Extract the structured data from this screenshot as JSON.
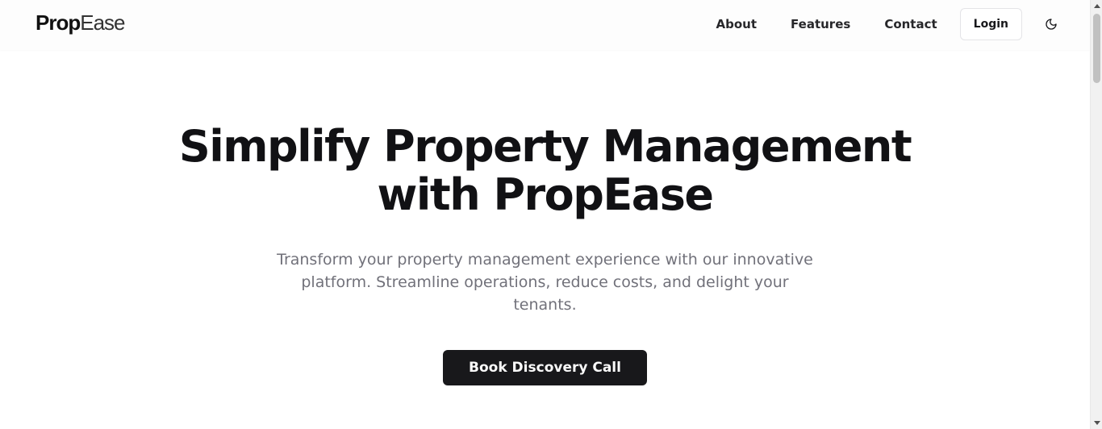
{
  "brand": {
    "logo_strong": "Prop",
    "logo_light": "Ease"
  },
  "nav": {
    "items": [
      {
        "label": "About"
      },
      {
        "label": "Features"
      },
      {
        "label": "Contact"
      }
    ],
    "login_label": "Login",
    "theme_icon": "moon-icon"
  },
  "hero": {
    "title_line1": "Simplify Property Management",
    "title_line2": "with PropEase",
    "subtitle": "Transform your property management experience with our innovative platform. Streamline operations, reduce costs, and delight your tenants.",
    "cta_label": "Book Discovery Call"
  },
  "colors": {
    "primary": "#18181b",
    "muted_text": "#71717a",
    "background": "#ffffff"
  }
}
